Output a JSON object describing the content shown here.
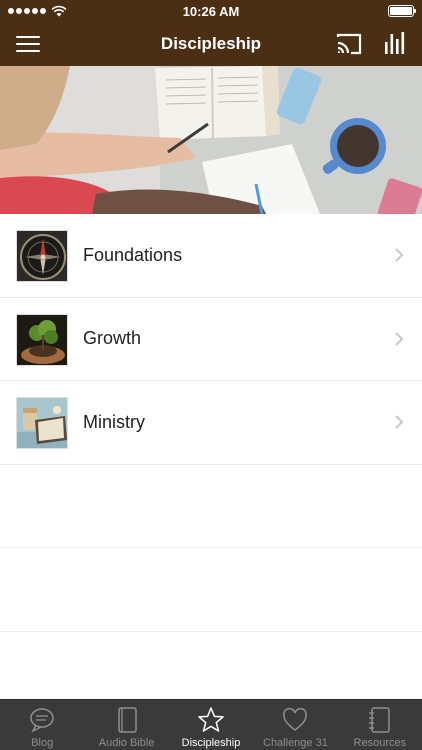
{
  "status_bar": {
    "time": "10:26 AM"
  },
  "nav": {
    "title": "Discipleship"
  },
  "list": {
    "items": [
      {
        "label": "Foundations",
        "icon": "compass-image"
      },
      {
        "label": "Growth",
        "icon": "plant-in-hands-image"
      },
      {
        "label": "Ministry",
        "icon": "coffee-and-bible-image"
      }
    ]
  },
  "tabs": [
    {
      "label": "Blog",
      "icon": "speech-bubble-icon",
      "active": false
    },
    {
      "label": "Audio Bible",
      "icon": "book-icon",
      "active": false
    },
    {
      "label": "Discipleship",
      "icon": "star-icon",
      "active": true
    },
    {
      "label": "Challenge 31",
      "icon": "heart-icon",
      "active": false
    },
    {
      "label": "Resources",
      "icon": "notebook-icon",
      "active": false
    }
  ],
  "colors": {
    "nav_background": "#4a2f15",
    "tab_bar_background": "#3a3a3a",
    "tab_inactive": "#8e8e8e",
    "tab_active": "#ffffff"
  }
}
